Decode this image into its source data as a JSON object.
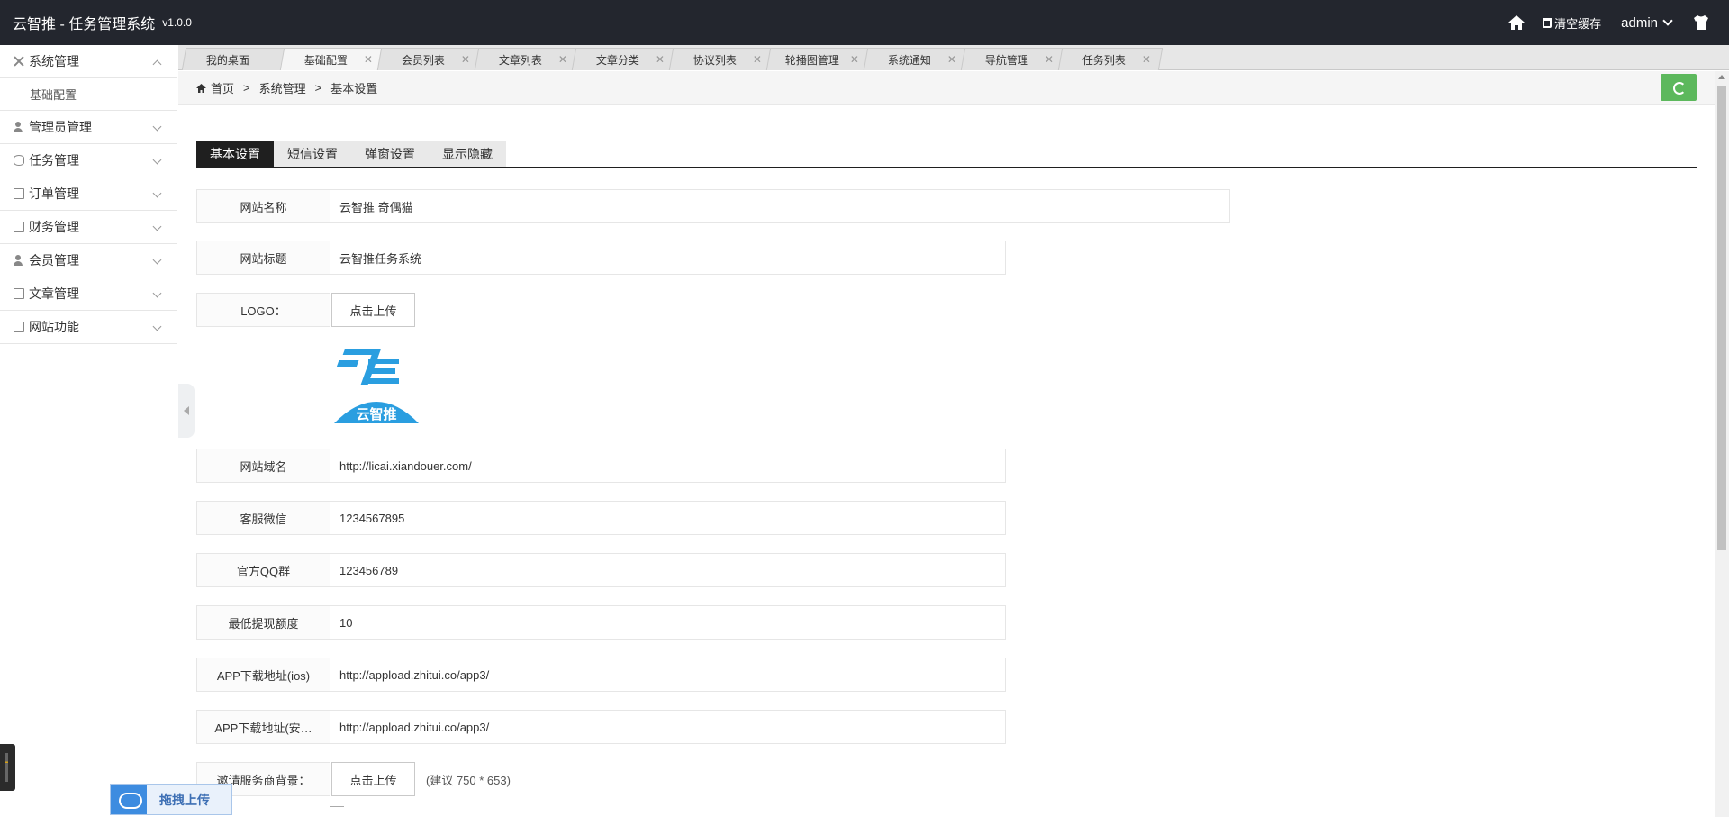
{
  "header": {
    "title": "云智推 - 任务管理系统",
    "version": "v1.0.0",
    "clear_cache": "清空缓存",
    "user": "admin"
  },
  "sidebar": {
    "items": [
      {
        "label": "系统管理",
        "expanded": true
      },
      {
        "label": "管理员管理"
      },
      {
        "label": "任务管理"
      },
      {
        "label": "订单管理"
      },
      {
        "label": "财务管理"
      },
      {
        "label": "会员管理"
      },
      {
        "label": "文章管理"
      },
      {
        "label": "网站功能"
      }
    ],
    "subitem": "基础配置"
  },
  "tabs": [
    "我的桌面",
    "基础配置",
    "会员列表",
    "文章列表",
    "文章分类",
    "协议列表",
    "轮播图管理",
    "系统通知",
    "导航管理",
    "任务列表"
  ],
  "breadcrumb": {
    "home": "首页",
    "level1": "系统管理",
    "level2": "基本设置",
    "sep": ">"
  },
  "subtabs": [
    "基本设置",
    "短信设置",
    "弹窗设置",
    "显示隐藏"
  ],
  "form": {
    "site_name_label": "网站名称",
    "site_name": "云智推 奇偶猫",
    "site_title_label": "网站标题",
    "site_title": "云智推任务系统",
    "logo_label": "LOGO：",
    "upload_label": "点击上传",
    "logo_text": "云智推",
    "domain_label": "网站域名",
    "domain": "http://licai.xiandouer.com/",
    "wechat_label": "客服微信",
    "wechat": "1234567895",
    "qq_label": "官方QQ群",
    "qq": "123456789",
    "min_withdraw_label": "最低提现额度",
    "min_withdraw": "10",
    "ios_label": "APP下载地址(ios)",
    "ios_url": "http://appload.zhitui.co/app3/",
    "android_label": "APP下载地址(安…",
    "android_url": "http://appload.zhitui.co/app3/",
    "invite_bg_label": "邀请服务商背景：",
    "invite_bg_hint": "(建议 750 * 653)"
  },
  "drag_upload": "拖拽上传",
  "colors": {
    "header_bg": "#23262e",
    "refresh": "#5cb85c",
    "logo_blue": "#2a9ee0"
  }
}
